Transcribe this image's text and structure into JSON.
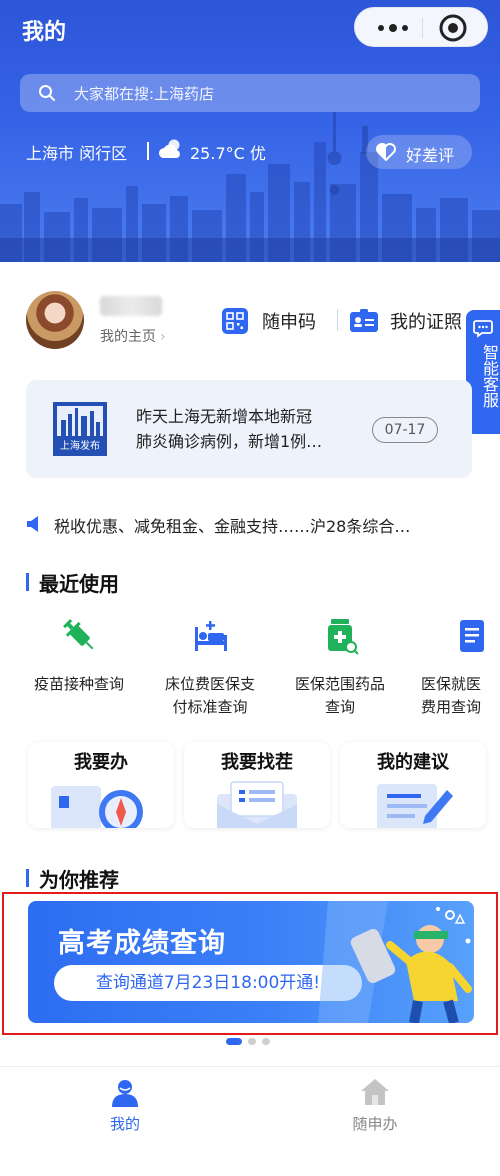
{
  "header": {
    "title": "我的",
    "search_placeholder": "大家都在搜:上海药店",
    "location": "上海市 闵行区",
    "weather": "25.7°C 优",
    "rating_label": "好差评"
  },
  "profile": {
    "homepage_label": "我的主页",
    "chevron": "›",
    "qr_code_label": "随申码",
    "certificate_label": "我的证照"
  },
  "customer_service": {
    "label": "智能客服"
  },
  "news": {
    "line1": "昨天上海无新增本地新冠",
    "line2": "肺炎确诊病例，新增1例…",
    "date": "07-17",
    "logo_text": "上海发布"
  },
  "ticker": {
    "text": "税收优惠、减免租金、金融支持……沪28条综合…"
  },
  "recent": {
    "title": "最近使用",
    "items": [
      {
        "line1": "疫苗接种查询",
        "line2": "",
        "icon": "syringe-icon"
      },
      {
        "line1": "床位费医保支",
        "line2": "付标准查询",
        "icon": "hospital-bed-icon"
      },
      {
        "line1": "医保范围药品",
        "line2": "查询",
        "icon": "medicine-bottle-icon"
      },
      {
        "line1": "医保就医",
        "line2": "费用查询",
        "icon": "document-icon"
      }
    ]
  },
  "cards": [
    {
      "label": "我要办",
      "icon": "compass-icon"
    },
    {
      "label": "我要找茬",
      "icon": "envelope-icon"
    },
    {
      "label": "我的建议",
      "icon": "edit-document-icon"
    }
  ],
  "recommend": {
    "title": "为你推荐",
    "banner_title": "高考成绩查询",
    "banner_subtitle": "查询通道7月23日18:00开通!"
  },
  "carousel": {
    "count": 3,
    "active_index": 0
  },
  "tabbar": [
    {
      "label": "我的",
      "icon": "person-icon",
      "active": true
    },
    {
      "label": "随申办",
      "icon": "home-icon",
      "active": false
    }
  ],
  "colors": {
    "primary": "#2f67f0",
    "header": "#3563e6",
    "highlight": "#e31b1b",
    "inactive": "#888888"
  }
}
